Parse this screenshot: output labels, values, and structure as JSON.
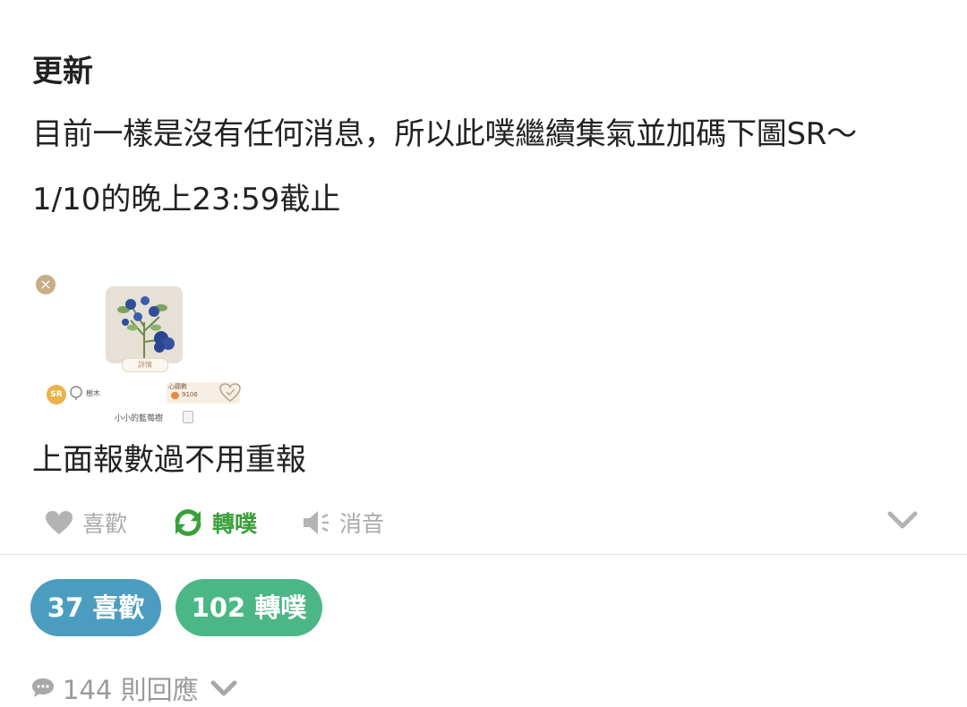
{
  "post": {
    "title": "更新",
    "line1": "目前一樣是沒有任何消息，所以此噗繼續集氣並加碼下圖SR～",
    "line2": "1/10的晚上23:59截止",
    "line3": "上面報數過不用重報",
    "card": {
      "close": "×",
      "detail_label": "詳情",
      "rarity": "SR",
      "type_label": "樹木",
      "heart_title": "心願數",
      "heart_value": "9106",
      "item_name": "小小的藍莓樹"
    }
  },
  "actions": {
    "like": "喜歡",
    "replurk": "轉噗",
    "mute": "消音"
  },
  "stats": {
    "likes": "37 喜歡",
    "replurks": "102 轉噗"
  },
  "responses": {
    "label": "144 則回應"
  },
  "colors": {
    "like_pill": "#4b9dc0",
    "replurk_pill": "#4cb786",
    "replurk_active": "#39a03a",
    "muted_gray": "#aaaaaa"
  },
  "icons": [
    "heart-icon",
    "replurk-icon",
    "speaker-mute-icon",
    "chevron-down-icon",
    "comment-bubble-icon",
    "close-icon"
  ]
}
